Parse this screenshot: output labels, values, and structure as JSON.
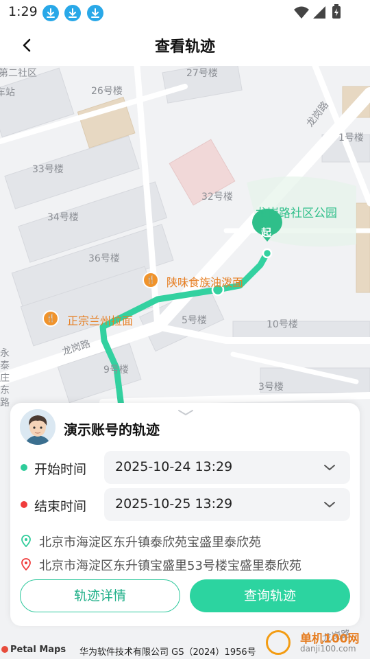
{
  "status_bar": {
    "time": "1:29",
    "icons": [
      "download-icon",
      "download-icon",
      "download-icon",
      "wifi-icon",
      "signal-icon",
      "battery-icon"
    ]
  },
  "header": {
    "title": "查看轨迹",
    "back_icon": "chevron-left-icon"
  },
  "map": {
    "labels": {
      "community_2": "第二社区",
      "station": "车站",
      "b27": "27号楼",
      "b26": "26号楼",
      "longgang_road_top": "龙岗路",
      "b1": "1号楼",
      "b33": "33号楼",
      "b32": "32号楼",
      "b34": "34号楼",
      "b36": "36号楼",
      "b5": "5号楼",
      "b10": "10号楼",
      "longgang_road_left": "龙岗路",
      "b9": "9号楼",
      "b3": "3号楼",
      "yongtai_road": "永泰庄东路",
      "longgang_road_bottom": "龙岗路"
    },
    "park_name": "龙岗路社区公园",
    "poi_1": "陕味食族油泼面",
    "poi_2": "正宗兰州拉面",
    "start_marker": "起",
    "track_color": "#33d1a0"
  },
  "card": {
    "title": "演示账号的轨迹",
    "start_label": "开始时间",
    "start_value": "2025-10-24 13:29",
    "end_label": "结束时间",
    "end_value": "2025-10-25 13:29",
    "start_address": "北京市海淀区东升镇泰欣苑宝盛里泰欣苑",
    "end_address": "北京市海淀区东升镇宝盛里53号楼宝盛里泰欣苑",
    "details_button": "轨迹详情",
    "query_button": "查询轨迹",
    "start_dot_color": "#2ecc9a",
    "end_dot_color": "#f03c3c"
  },
  "footer": {
    "map_brand": "Petal Maps",
    "copyright": "华为软件技术有限公司 GS（2024）1956号"
  },
  "watermark": {
    "name": "单机100网",
    "url": "danji100.com"
  }
}
